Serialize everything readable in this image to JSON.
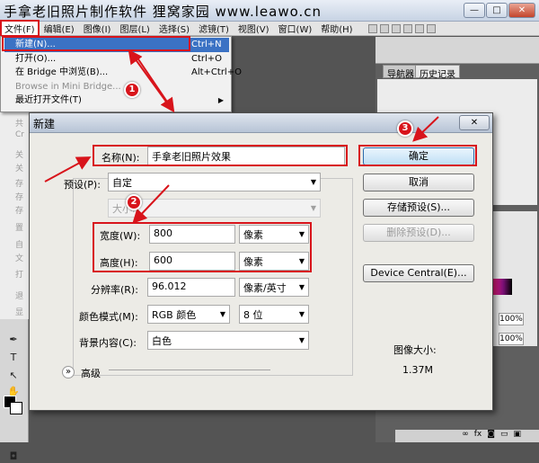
{
  "window": {
    "title": "手拿老旧照片制作软件  狸窝家园 www.leawo.cn",
    "buttons": [
      "—",
      "□",
      "✕"
    ]
  },
  "menubar": {
    "items": [
      "文件(F)",
      "编辑(E)",
      "图像(I)",
      "图层(L)",
      "选择(S)",
      "滤镜(T)",
      "视图(V)",
      "窗口(W)",
      "帮助(H)"
    ]
  },
  "file_menu": {
    "new_label": "新建(N)...",
    "new_shortcut": "Ctrl+N",
    "open_label": "打开(O)...",
    "open_shortcut": "Ctrl+O",
    "bridge_label": "在 Bridge 中浏览(B)...",
    "bridge_shortcut": "Alt+Ctrl+O",
    "mini_bridge_label": "Browse in Mini Bridge...",
    "recent_label": "最近打开文件(T)",
    "recent_arrow": "▶",
    "hidden_items": [
      "共",
      "Cr",
      "关",
      "关",
      "存",
      "存",
      "存",
      "置",
      "自",
      "文",
      "打",
      "退",
      "显"
    ]
  },
  "right_panel": {
    "tab_navigator": "导航器",
    "tab_history": "历史记录",
    "zoom_1": "100%",
    "zoom_2": "100%"
  },
  "dialog": {
    "title": "新建",
    "close": "✕",
    "name_label": "名称(N):",
    "name_value": "手拿老旧照片效果",
    "preset_label": "预设(P):",
    "preset_value": "自定",
    "size_label": "大小:",
    "width_label": "宽度(W):",
    "width_value": "800",
    "width_unit": "像素",
    "height_label": "高度(H):",
    "height_value": "600",
    "height_unit": "像素",
    "resolution_label": "分辨率(R):",
    "resolution_value": "96.012",
    "resolution_unit": "像素/英寸",
    "color_mode_label": "颜色模式(M):",
    "color_mode_value": "RGB 颜色",
    "bit_depth_value": "8 位",
    "background_label": "背景内容(C):",
    "background_value": "白色",
    "advanced_label": "高级",
    "advanced_icon": "»",
    "ok_button": "确定",
    "cancel_button": "取消",
    "save_preset_button": "存储预设(S)...",
    "delete_preset_button": "删除预设(D)...",
    "device_central_button": "Device Central(E)...",
    "image_size_label": "图像大小:",
    "image_size_value": "1.37M"
  },
  "callouts": [
    "1",
    "2",
    "3"
  ],
  "colors": {
    "highlight_red": "#d8141b",
    "menu_select_blue": "#3b72c4"
  }
}
